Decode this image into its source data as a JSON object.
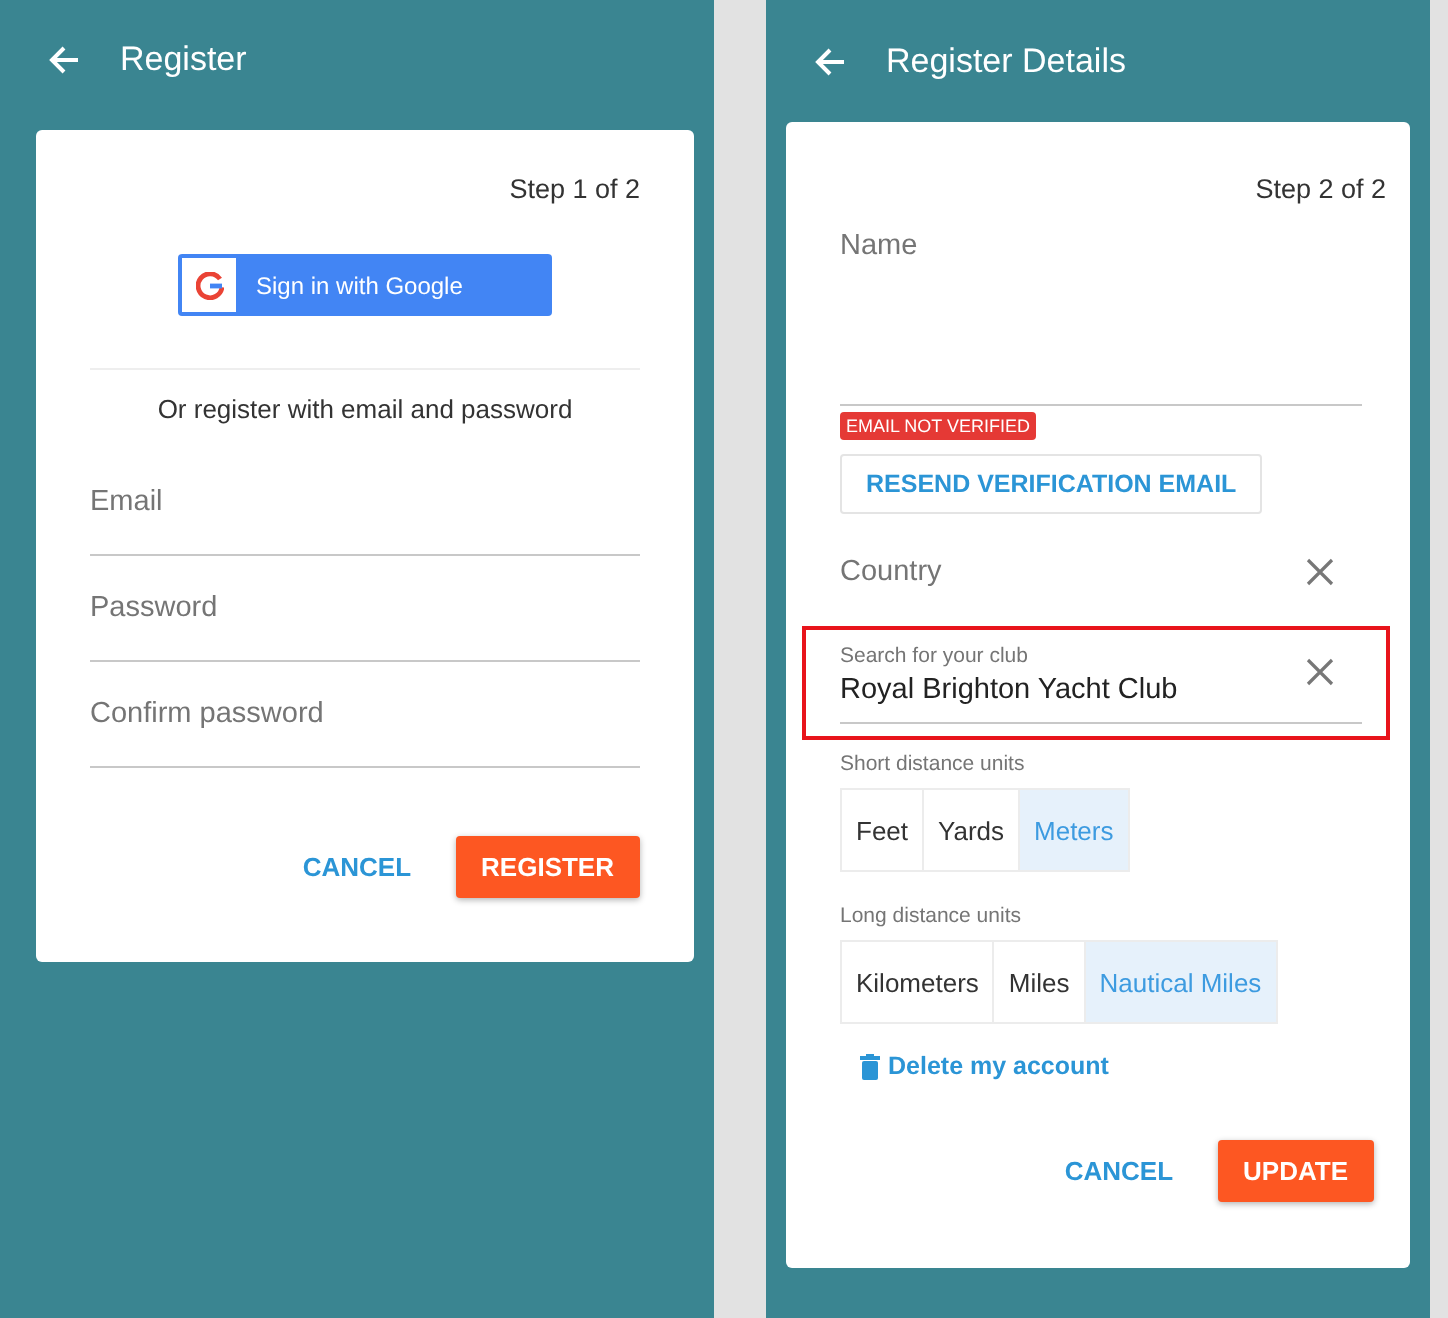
{
  "register_screen": {
    "app_bar": {
      "title": "Register"
    },
    "step": "Step 1 of 2",
    "google_button": {
      "label": "Sign in with Google"
    },
    "divider_text": "Or register with email and password",
    "fields": [
      {
        "label": "Email"
      },
      {
        "label": "Password"
      },
      {
        "label": "Confirm password"
      }
    ],
    "actions": [
      {
        "label": "CANCEL",
        "kind": "text"
      },
      {
        "label": "REGISTER",
        "kind": "primary"
      }
    ]
  },
  "details_screen": {
    "app_bar": {
      "title": "Register Details"
    },
    "step": "Step 2 of 2",
    "fields": [
      {
        "kind": "name",
        "label": "Name"
      },
      {
        "kind": "email",
        "badge": "EMAIL NOT VERIFIED",
        "action": "RESEND VERIFICATION EMAIL"
      },
      {
        "kind": "select",
        "label": "Country",
        "clearable": true,
        "highlighted": false
      },
      {
        "kind": "select",
        "label": "Search for your club",
        "value": "Royal Brighton Yacht Club",
        "clearable": true,
        "highlighted": true
      }
    ],
    "unit_groups": [
      {
        "label": "Short distance units",
        "options": [
          {
            "label": "Feet",
            "selected": false
          },
          {
            "label": "Yards",
            "selected": false
          },
          {
            "label": "Meters",
            "selected": true
          }
        ]
      },
      {
        "label": "Long distance units",
        "options": [
          {
            "label": "Kilometers",
            "selected": false
          },
          {
            "label": "Miles",
            "selected": false
          },
          {
            "label": "Nautical Miles",
            "selected": true
          }
        ]
      }
    ],
    "delete_link": "Delete my account",
    "actions": [
      {
        "label": "CANCEL",
        "kind": "text"
      },
      {
        "label": "UPDATE",
        "kind": "primary"
      }
    ]
  }
}
